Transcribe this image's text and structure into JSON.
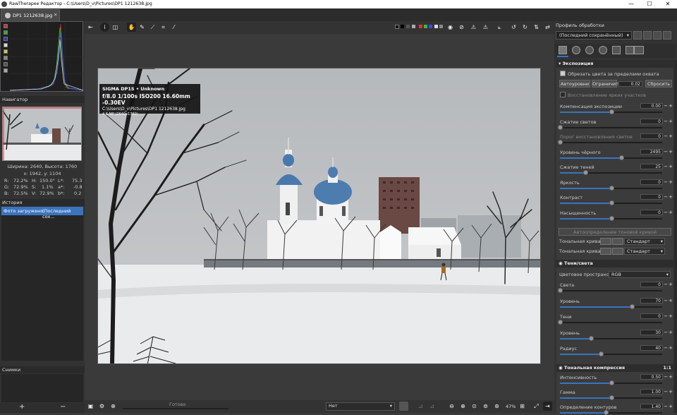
{
  "window": {
    "title": "RawTherapee Редактор - C:\\Users\\D_v\\Pictures\\DP1 1212638.jpg",
    "minimize": "—",
    "maximize": "☐",
    "close": "✕"
  },
  "tab": {
    "label": "DP1 1212638.jpg",
    "close": "✕"
  },
  "navigator": {
    "header": "Навигатор",
    "size": "Ширина: 2640, Высота: 1760",
    "coords": "x: 1942, y: 1104",
    "values": [
      {
        "k": "R:",
        "v": "72.2%",
        "k2": "H:",
        "v2": "150.0°",
        "k3": "L*:",
        "v3": "75.3"
      },
      {
        "k": "G:",
        "v": "72.9%",
        "k2": "S:",
        "v2": "1.1%",
        "k3": "a*:",
        "v3": "-0.8"
      },
      {
        "k": "B:",
        "v": "72.5%",
        "k2": "V:",
        "v2": "72.9%",
        "k3": "b*:",
        "v3": "0.2"
      }
    ]
  },
  "history": {
    "header": "История",
    "row_col1": "Фото загружено",
    "row_col2": "(Последний сох..."
  },
  "snapshots": {
    "header": "Снимки",
    "add": "+",
    "remove": "−"
  },
  "info": {
    "camera": "SIGMA DP1S  •  Unknown",
    "exposure": "f/8.0  1/100s  ISO200  16.60mm  -0.30EV",
    "path": "C:\\Users\\D_v\\Pictures\\DP1 1212638.jpg",
    "mp": "4.6 MP (2640x1760)"
  },
  "bottom": {
    "status": "Готово",
    "combo": "Нет",
    "zoom": "47%"
  },
  "right": {
    "title": "Профиль обработки",
    "profile": "(Последний сохранённый)",
    "exposure": {
      "header": "Экспозиция",
      "clip_label": "Обрезать цвета за пределами охвата",
      "auto_btn": "Автоуровни",
      "limit_btn": "Ограничить",
      "limit_val": "0.02",
      "reset_btn": "Сбросить",
      "highlight_recovery": "Восстановление ярких участков",
      "sliders": [
        {
          "label": "Компенсация экспозиции",
          "value": "0.00",
          "pos": 0.5
        },
        {
          "label": "Сжатие светов",
          "value": "0",
          "pos": 0.0
        },
        {
          "label": "Порог восстановления светов",
          "value": "0",
          "pos": 0.0,
          "dim": true
        },
        {
          "label": "Уровень чёрного",
          "value": "2495",
          "pos": 0.6
        },
        {
          "label": "Сжатие теней",
          "value": "25",
          "pos": 0.25
        },
        {
          "label": "Яркость",
          "value": "0",
          "pos": 0.5
        },
        {
          "label": "Контраст",
          "value": "0",
          "pos": 0.5
        },
        {
          "label": "Насыщенность",
          "value": "0",
          "pos": 0.5
        }
      ],
      "auto_tone": "Автоопределение тоновой кривой",
      "curve1_label": "Тональная кривая 1:",
      "curve2_label": "Тональная кривая 2:",
      "curve_mode": "Стандарт"
    },
    "shadows": {
      "header": "Тени/света",
      "colorspace_label": "Цветовое пространство:",
      "colorspace": "RGB",
      "sliders": [
        {
          "label": "Света",
          "value": "0",
          "pos": 0.0
        },
        {
          "label": "Уровень",
          "value": "70",
          "pos": 0.7
        },
        {
          "label": "Тени",
          "value": "0",
          "pos": 0.0
        },
        {
          "label": "Уровень",
          "value": "30",
          "pos": 0.3
        },
        {
          "label": "Радиус",
          "value": "40",
          "pos": 0.4
        }
      ]
    },
    "tonal": {
      "header": "Тональная компрессия",
      "ratio": "1:1",
      "sliders": [
        {
          "label": "Интенсивность",
          "value": "0.50",
          "pos": 0.5
        },
        {
          "label": "Гамма",
          "value": "1.00",
          "pos": 0.5
        },
        {
          "label": "Определение контуров",
          "value": "1.40",
          "pos": 0.45
        }
      ]
    }
  },
  "colors": {
    "accent": "#3a74bf",
    "panel": "#333333"
  }
}
